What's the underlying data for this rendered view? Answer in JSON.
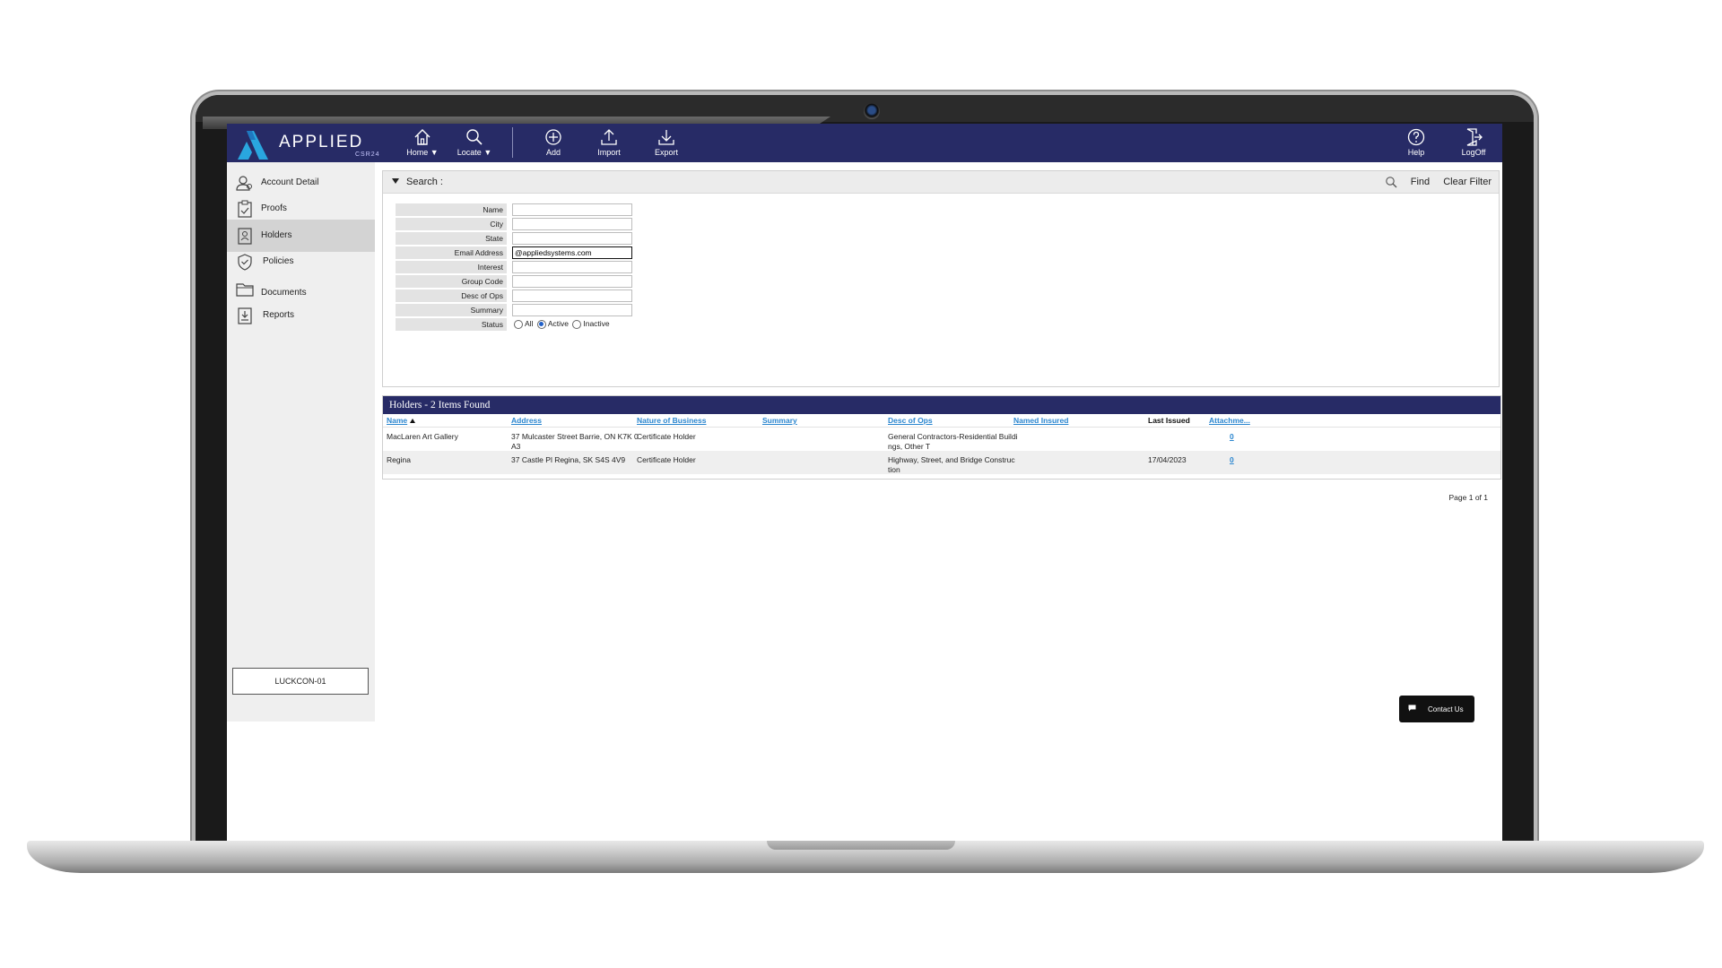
{
  "app": {
    "brand": "APPLIED",
    "brand_sub": "CSR24"
  },
  "toolbar": {
    "home": "Home",
    "locate": "Locate",
    "add": "Add",
    "import": "Import",
    "export": "Export",
    "help": "Help",
    "logoff": "LogOff"
  },
  "sidebar": {
    "items": [
      {
        "label": "Account Detail",
        "icon": "account-icon"
      },
      {
        "label": "Proofs",
        "icon": "clipboard-icon"
      },
      {
        "label": "Holders",
        "icon": "holder-icon",
        "active": true
      },
      {
        "label": "Policies",
        "icon": "shield-icon"
      },
      {
        "label": "Documents",
        "icon": "folder-icon"
      },
      {
        "label": "Reports",
        "icon": "report-icon"
      }
    ],
    "user": "LUCKCON-01"
  },
  "search": {
    "title": "Search :",
    "find": "Find",
    "clear": "Clear Filter",
    "fields": [
      {
        "label": "Name",
        "value": ""
      },
      {
        "label": "City",
        "value": ""
      },
      {
        "label": "State",
        "value": ""
      },
      {
        "label": "Email Address",
        "value": "@appliedsystems.com"
      },
      {
        "label": "Interest",
        "value": ""
      },
      {
        "label": "Group Code",
        "value": ""
      },
      {
        "label": "Desc of Ops",
        "value": ""
      },
      {
        "label": "Summary",
        "value": ""
      }
    ],
    "status": {
      "label": "Status",
      "options": [
        "All",
        "Active",
        "Inactive"
      ],
      "selected": "Active"
    }
  },
  "results": {
    "title": "Holders - 2 Items Found",
    "columns": [
      "Name",
      "Address",
      "Nature of Business",
      "Summary",
      "Desc of Ops",
      "Named Insured",
      "Last Issued",
      "Attachme..."
    ],
    "rows": [
      {
        "name": "MacLaren Art Gallery",
        "address_1": "37 Mulcaster Street Barrie, ON K7K 0",
        "address_2": "A3",
        "nature": "Certificate Holder",
        "summary": "",
        "desc_1": "General Contractors-Residential Buildi",
        "desc_2": "ngs, Other T",
        "named_insured": "",
        "last_issued": "",
        "attachments": "0"
      },
      {
        "name": "Regina",
        "address_1": "37 Castle Pl Regina, SK S4S 4V9",
        "address_2": "",
        "nature": "Certificate Holder",
        "summary": "",
        "desc_1": "Highway, Street, and Bridge Construc",
        "desc_2": "tion",
        "named_insured": "",
        "last_issued": "17/04/2023",
        "attachments": "0"
      }
    ],
    "pager": "Page 1 of 1"
  },
  "contact": "Contact Us",
  "colors": {
    "nav": "#272b66",
    "accent": "#29a6df",
    "link": "#2b86cf"
  }
}
